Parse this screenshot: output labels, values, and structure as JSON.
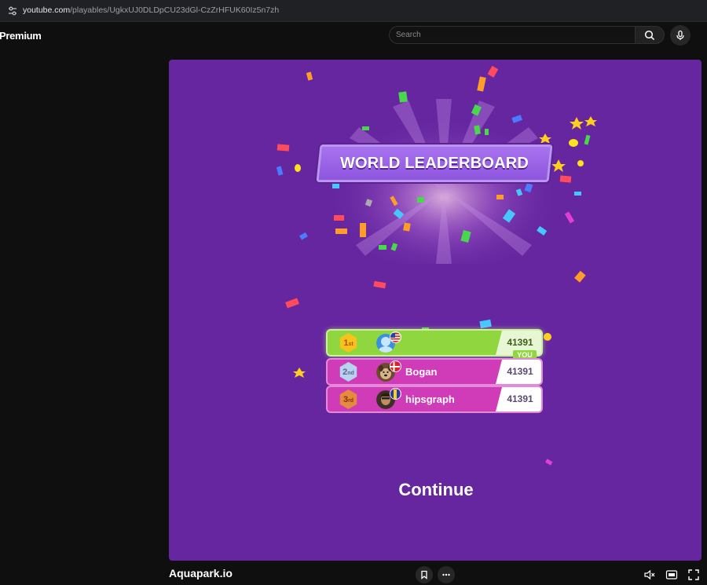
{
  "browser": {
    "url_host": "youtube.com",
    "url_path": "/playables/UgkxUJ0DLDpCU23dGl-CzZrHFUK60Iz5n7zh"
  },
  "header": {
    "logo": "Premium",
    "search_placeholder": "Search"
  },
  "game": {
    "title_banner": "WORLD LEADERBOARD",
    "you_badge": "YOU",
    "continue_label": "Continue",
    "colors": {
      "background": "#6526a0",
      "first_row": "#8fd63f",
      "other_rows": "#d03bb8"
    },
    "leaderboard": [
      {
        "rank": "1st",
        "name": "",
        "score": "41391",
        "flag": "us-flag-icon",
        "is_you": true
      },
      {
        "rank": "2nd",
        "name": "Bogan",
        "score": "41391",
        "flag": "denmark-flag-icon",
        "is_you": false
      },
      {
        "rank": "3rd",
        "name": "hipsgraph",
        "score": "41391",
        "flag": "barbados-flag-icon",
        "is_you": false
      }
    ]
  },
  "footer": {
    "game_name": "Aquapark.io",
    "icons": [
      "bookmark-icon",
      "more-icon",
      "mute-icon",
      "theater-mode-icon",
      "fullscreen-icon"
    ]
  }
}
